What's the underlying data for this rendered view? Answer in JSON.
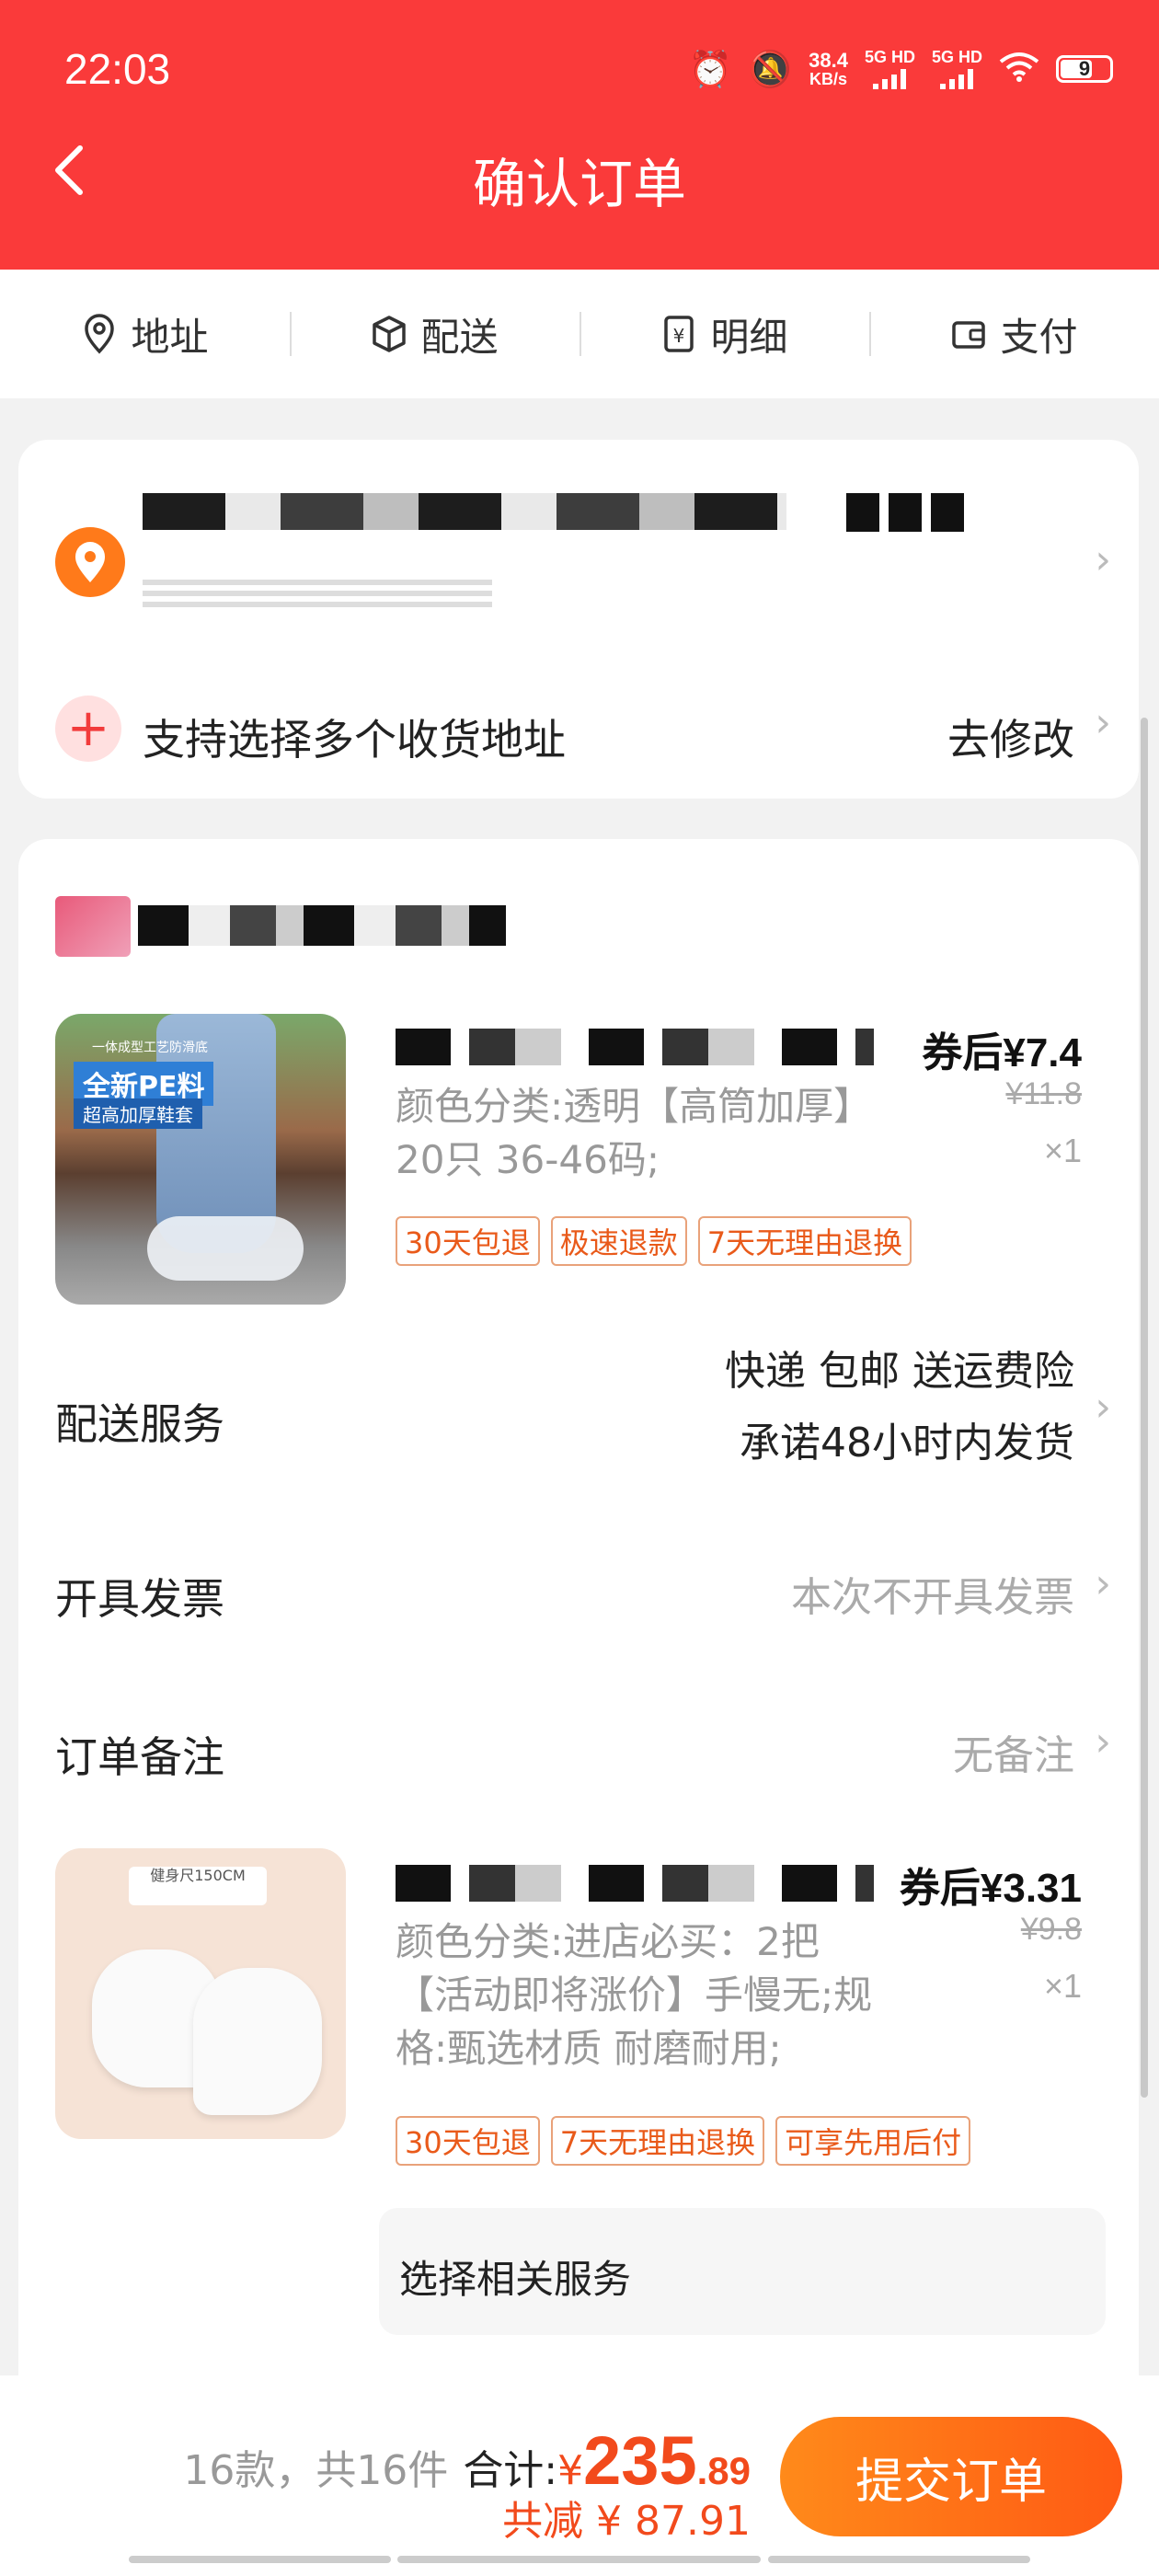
{
  "status_bar": {
    "time": "22:03",
    "net_speed_value": "38.4",
    "net_speed_unit": "KB/s",
    "signal1": "5G HD",
    "signal2": "5G HD",
    "battery": "9"
  },
  "header": {
    "title": "确认订单"
  },
  "tabs": [
    {
      "label": "地址",
      "icon": "location-pin-icon"
    },
    {
      "label": "配送",
      "icon": "package-icon"
    },
    {
      "label": "明细",
      "icon": "receipt-icon"
    },
    {
      "label": "支付",
      "icon": "wallet-icon"
    }
  ],
  "address": {
    "multi_address_label": "支持选择多个收货地址",
    "modify_label": "去修改"
  },
  "products": [
    {
      "price_after": "券后¥7.4",
      "price_original": "¥11.8",
      "quantity": "×1",
      "spec": "颜色分类:透明【高筒加厚】20只 36-46码;",
      "tags": [
        "30天包退",
        "极速退款",
        "7天无理由退换"
      ],
      "image_text": {
        "small": "一体成型工艺防滑底",
        "big": "全新PE料",
        "sub": "超高加厚鞋套"
      }
    },
    {
      "price_after": "券后¥3.31",
      "price_original": "¥9.8",
      "quantity": "×1",
      "spec": "颜色分类:进店必买：2把【活动即将涨价】手慢无;规格:甄选材质 耐磨耐用;",
      "tags": [
        "30天包退",
        "7天无理由退换",
        "可享先用后付"
      ],
      "image_text": {
        "tag": "健身尺150CM"
      }
    }
  ],
  "delivery": {
    "label": "配送服务",
    "line1": "快递 包邮 送运费险",
    "line2": "承诺48小时内发货"
  },
  "invoice": {
    "label": "开具发票",
    "value": "本次不开具发票"
  },
  "remark": {
    "label": "订单备注",
    "value": "无备注"
  },
  "related_service": {
    "label": "选择相关服务"
  },
  "bottom": {
    "count": "16款，共16件",
    "total_label": "合计:",
    "currency": "¥",
    "total_int": "235",
    "total_dec": ".89",
    "saved": "共减 ¥ 87.91",
    "submit": "提交订单"
  },
  "colors": {
    "header_red": "#fa3a3a",
    "accent_orange": "#ff6a14",
    "price_orange": "#f24a1c",
    "pin_orange": "#ff7a1a"
  }
}
